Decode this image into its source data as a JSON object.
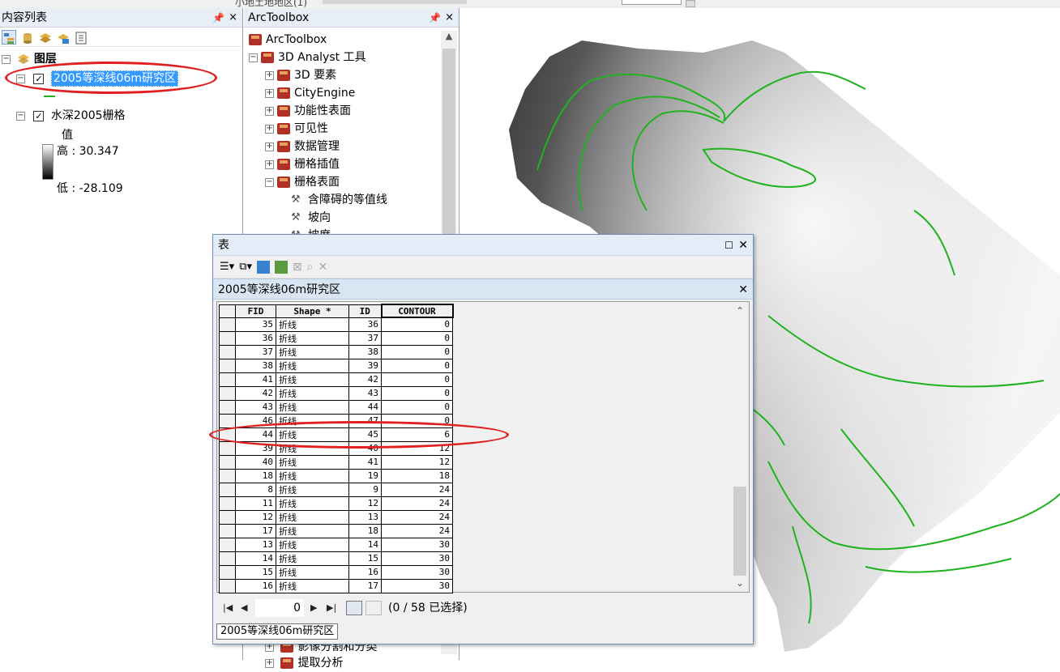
{
  "top_strip": {
    "partial_text": "小地土地地区(1)"
  },
  "toc": {
    "title": "内容列表",
    "pin": "ᵖ",
    "close": "×",
    "group_label": "图层",
    "layer1_label": "2005等深线06m研究区",
    "layer2_label": "水深2005栅格",
    "legend_title": "值",
    "legend_high": "高 : 30.347",
    "legend_low": "低 : -28.109"
  },
  "toolbox": {
    "title": "ArcToolbox",
    "root": "ArcToolbox",
    "items": [
      {
        "label": "3D Analyst 工具",
        "expander": "⊟",
        "level": 1
      },
      {
        "label": "3D 要素",
        "expander": "⊞",
        "level": 2
      },
      {
        "label": "CityEngine",
        "expander": "⊞",
        "level": 2
      },
      {
        "label": "功能性表面",
        "expander": "⊞",
        "level": 2
      },
      {
        "label": "可见性",
        "expander": "⊞",
        "level": 2
      },
      {
        "label": "数据管理",
        "expander": "⊞",
        "level": 2
      },
      {
        "label": "栅格插值",
        "expander": "⊞",
        "level": 2
      },
      {
        "label": "栅格表面",
        "expander": "⊟",
        "level": 2
      },
      {
        "label": "含障碍的等值线",
        "expander": "",
        "level": 3
      },
      {
        "label": "坡向",
        "expander": "",
        "level": 3
      },
      {
        "label": "坡度",
        "expander": "",
        "level": 3
      }
    ],
    "bottom_item": "影像分割和分类",
    "bottom_item2": "提取分析"
  },
  "table_window": {
    "title": "表",
    "subtitle": "2005等深线06m研究区",
    "columns": [
      "FID",
      "Shape *",
      "ID",
      "CONTOUR"
    ],
    "rows": [
      [
        "35",
        "折线",
        "36",
        "0"
      ],
      [
        "36",
        "折线",
        "37",
        "0"
      ],
      [
        "37",
        "折线",
        "38",
        "0"
      ],
      [
        "38",
        "折线",
        "39",
        "0"
      ],
      [
        "41",
        "折线",
        "42",
        "0"
      ],
      [
        "42",
        "折线",
        "43",
        "0"
      ],
      [
        "43",
        "折线",
        "44",
        "0"
      ],
      [
        "46",
        "折线",
        "47",
        "0"
      ],
      [
        "44",
        "折线",
        "45",
        "6"
      ],
      [
        "39",
        "折线",
        "40",
        "12"
      ],
      [
        "40",
        "折线",
        "41",
        "12"
      ],
      [
        "18",
        "折线",
        "19",
        "18"
      ],
      [
        "8",
        "折线",
        "9",
        "24"
      ],
      [
        "11",
        "折线",
        "12",
        "24"
      ],
      [
        "12",
        "折线",
        "13",
        "24"
      ],
      [
        "17",
        "折线",
        "18",
        "24"
      ],
      [
        "13",
        "折线",
        "14",
        "30"
      ],
      [
        "14",
        "折线",
        "15",
        "30"
      ],
      [
        "15",
        "折线",
        "16",
        "30"
      ],
      [
        "16",
        "折线",
        "17",
        "30"
      ]
    ],
    "record_value": "0",
    "status": "(0 / 58 已选择)",
    "tab_label": "2005等深线06m研究区"
  },
  "colors": {
    "contour_green": "#1fb31f",
    "highlight_red": "#e02020",
    "selection_blue": "#3399ff"
  }
}
